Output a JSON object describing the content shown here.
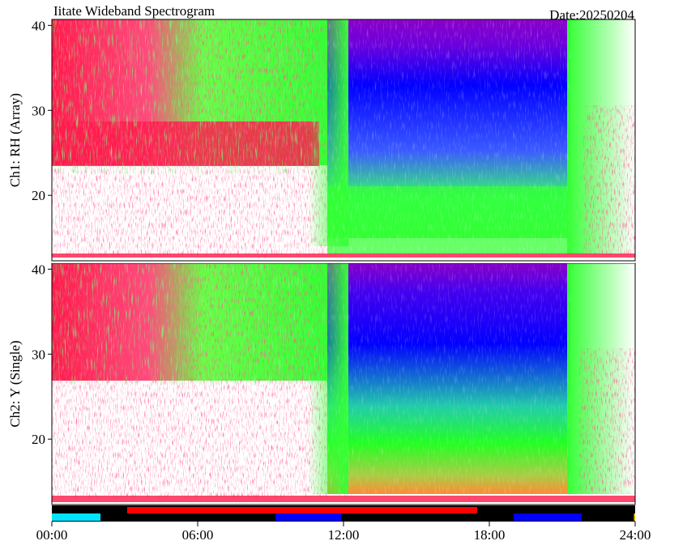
{
  "chart_data": {
    "type": "heatmap",
    "title": "Iitate Wideband Spectrogram",
    "date_label": "Date:20250204",
    "x_ticks": [
      "00:00",
      "06:00",
      "12:00",
      "18:00",
      "24:00"
    ],
    "x_range_hours": [
      0,
      24
    ],
    "panels": [
      {
        "ylabel": "Ch1: RH (Array)",
        "y_ticks": [
          20,
          30,
          40
        ],
        "y_range": [
          12.3,
          40.7
        ]
      },
      {
        "ylabel": "Ch2: Y (Single)",
        "y_ticks": [
          20,
          30,
          40
        ],
        "y_range": [
          12.3,
          40.7
        ]
      }
    ],
    "status_bar": [
      {
        "start": 0.0,
        "end": 2.0,
        "row": "bottom",
        "color": "#00e5ff"
      },
      {
        "start": 3.1,
        "end": 17.5,
        "row": "top",
        "color": "#ff0000"
      },
      {
        "start": 9.2,
        "end": 11.9,
        "row": "bottom",
        "color": "#0000ff"
      },
      {
        "start": 19.0,
        "end": 21.8,
        "row": "bottom",
        "color": "#0000ff"
      },
      {
        "start": 23.95,
        "end": 24.0,
        "row": "bottom",
        "color": "#ffd000"
      }
    ],
    "grid": false,
    "colors": {
      "deep": "#8a00c8",
      "blue": "#0000ff",
      "green": "#33ff33",
      "red": "#ff1a4a",
      "white": "#ffffff"
    }
  }
}
